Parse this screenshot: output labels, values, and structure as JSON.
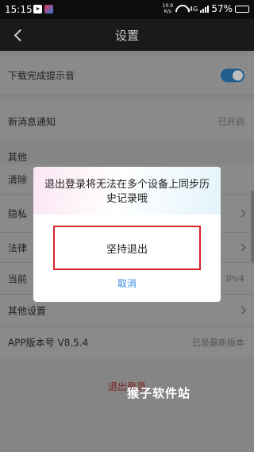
{
  "status_bar": {
    "time": "15:15",
    "net_speed_value": "10.9",
    "net_speed_unit": "K/s",
    "signal": "4G",
    "battery": "57%",
    "battery_level": 0.57
  },
  "nav": {
    "title": "设置"
  },
  "settings": {
    "download_tone": "下载完成提示音",
    "new_message": {
      "label": "新消息通知",
      "value": "已开启"
    },
    "other_header": "其他",
    "clear_cache_partial": "清除",
    "privacy_partial": "隐私",
    "legal_partial": "法律",
    "current_partial": "当前",
    "current_value_partial": "IPv4",
    "other_settings": "其他设置",
    "app_version": {
      "label": "APP版本号 V8.5.4",
      "value": "已是最新版本"
    },
    "logout": "退出登录"
  },
  "dialog": {
    "message": "退出登录将无法在多个设备上同步历史记录哦",
    "confirm": "坚持退出",
    "cancel": "取消"
  },
  "watermark": "猴子软件站"
}
